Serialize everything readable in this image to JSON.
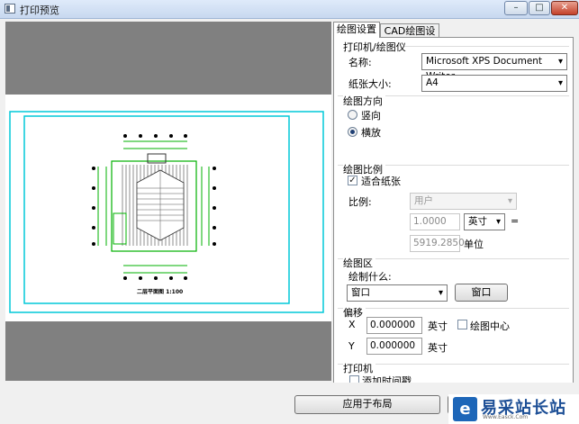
{
  "window": {
    "title": "打印预览",
    "minimize": "–",
    "maximize": "□",
    "close": "✕"
  },
  "tabs": [
    {
      "label": "绘图设置"
    },
    {
      "label": "CAD绘图设置"
    }
  ],
  "printer": {
    "section_title": "打印机/绘图仪",
    "name_label": "名称:",
    "name_value": "Microsoft XPS Document Writer",
    "paper_label": "纸张大小:",
    "paper_value": "A4"
  },
  "orientation": {
    "section_title": "绘图方向",
    "portrait": "竖向",
    "landscape": "横放",
    "selected": "landscape"
  },
  "scale": {
    "section_title": "绘图比例",
    "fit_label": "适合纸张",
    "fit_checked": true,
    "ratio_label": "比例:",
    "ratio_value": "用户",
    "value1": "1.0000",
    "unit_combo": "英寸",
    "equals": "=",
    "value2": "5919.2850",
    "unit_label": "单位"
  },
  "area": {
    "section_title": "绘图区",
    "what_label": "绘制什么:",
    "what_value": "窗口",
    "window_button": "窗口"
  },
  "offset": {
    "section_title": "偏移",
    "x_label": "X",
    "x_value": "0.000000",
    "x_unit": "英寸",
    "center_label": "绘图中心",
    "y_label": "Y",
    "y_value": "0.000000",
    "y_unit": "英寸"
  },
  "print": {
    "section_title": "打印机",
    "timestamp_label": "添加时间戳"
  },
  "footer": {
    "apply_button": "应用于布局"
  },
  "watermark": {
    "logo": "e",
    "name": "易采站长站",
    "sub": "Www.Easck.Com"
  },
  "drawing": {
    "title_block": "二层平面图 1:100"
  },
  "colors": {
    "cad_line": "#00c8d8",
    "cad_wall": "#00b000",
    "preview_bg": "#808080"
  }
}
